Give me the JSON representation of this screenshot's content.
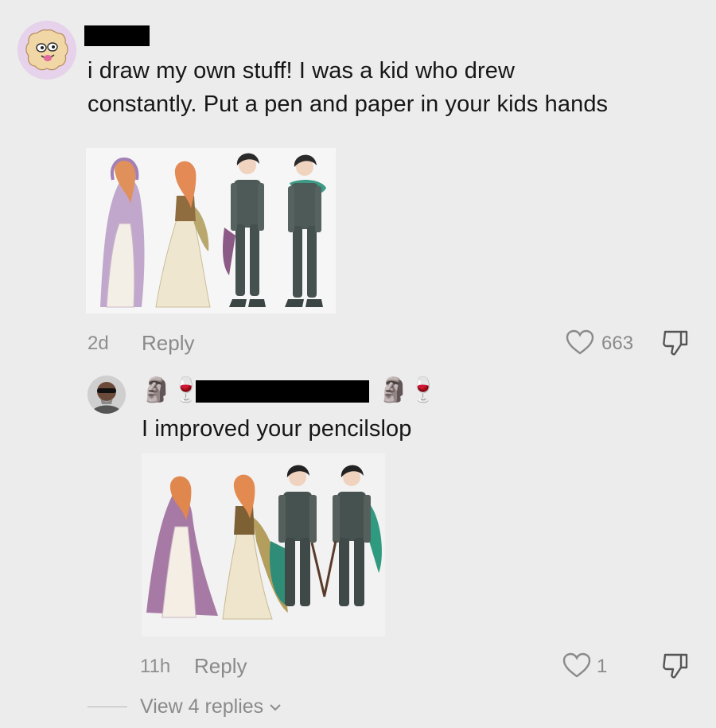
{
  "comment1": {
    "text_line1": "i draw my own stuff! I was a kid who drew",
    "text_line2": "constantly. Put a pen and paper in your kids hands",
    "time": "2d",
    "reply_label": "Reply",
    "like_count": "663"
  },
  "comment2": {
    "emoji_left": "🗿🍷",
    "emoji_right": "🗿🍷",
    "text": "I improved your pencilslop",
    "time": "11h",
    "reply_label": "Reply",
    "like_count": "1",
    "view_replies_label": "View 4 replies"
  },
  "icons": {
    "heart": "heart-outline-icon",
    "dislike": "thumbs-down-icon",
    "chevron": "chevron-down-icon"
  }
}
